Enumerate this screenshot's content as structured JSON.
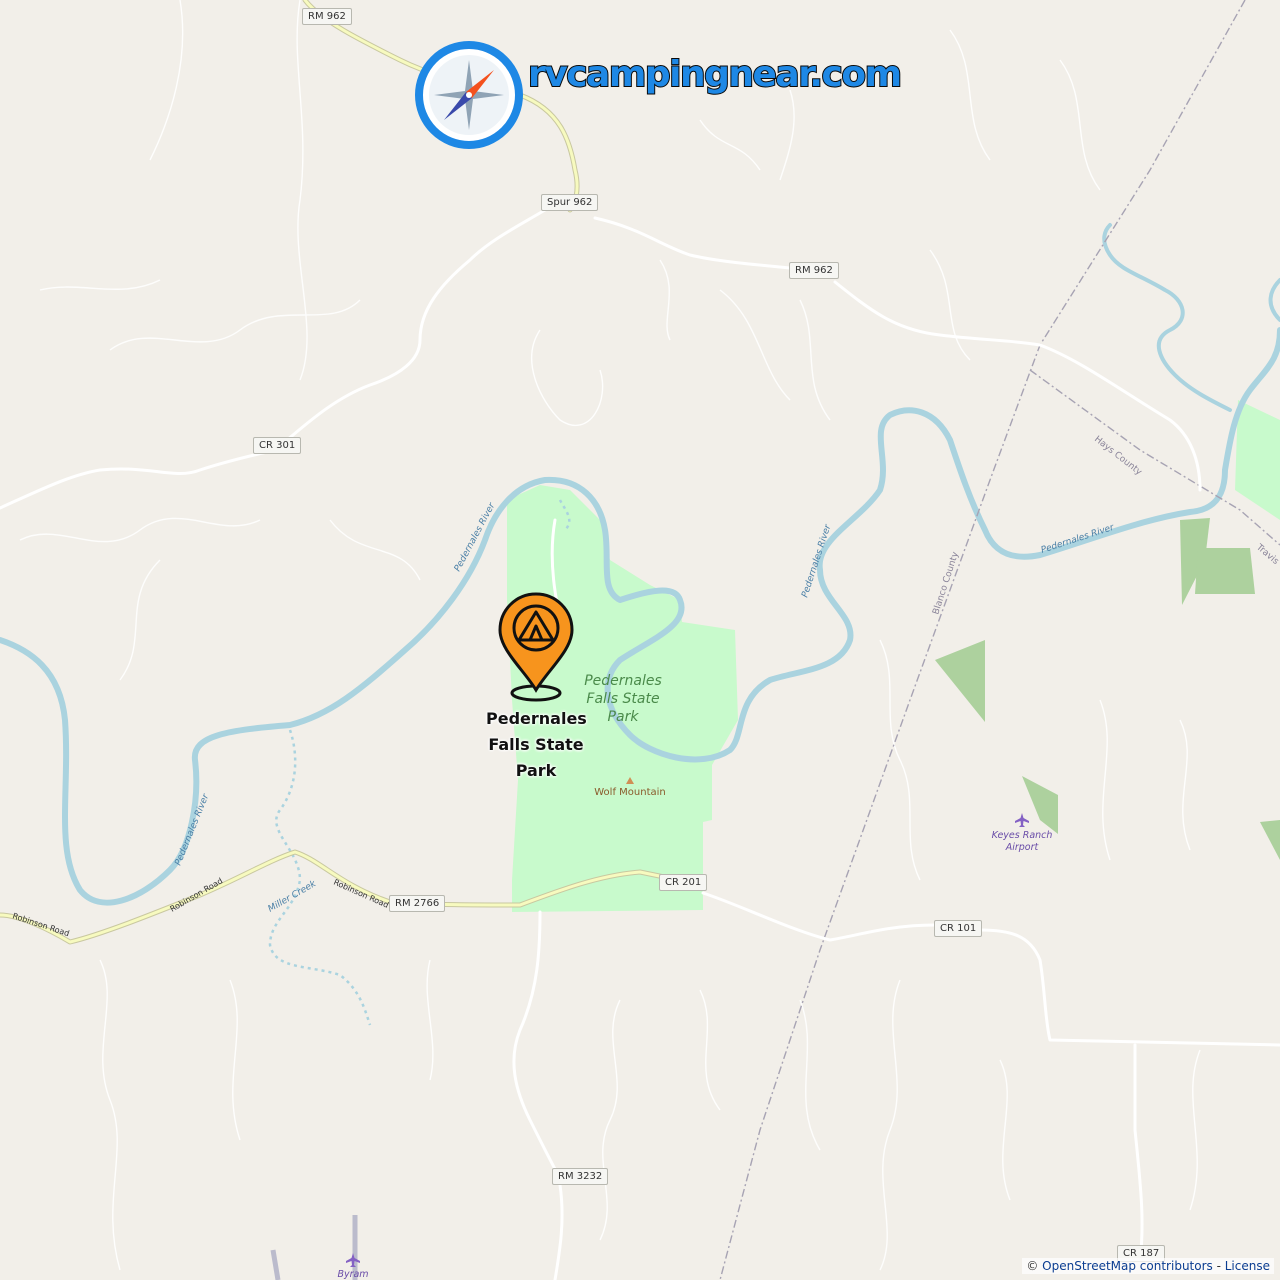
{
  "brand": {
    "text": "rvcampingnear.com",
    "icon": "compass-icon"
  },
  "marker": {
    "label": "Pedernales Falls State Park",
    "icon": "tent-icon"
  },
  "road_labels": {
    "rm962_top": "RM 962",
    "spur962": "Spur 962",
    "rm962_mid": "RM 962",
    "cr301": "CR 301",
    "cr201": "CR 201",
    "rm2766": "RM 2766",
    "cr101": "CR 101",
    "rm3232": "RM 3232",
    "cr187": "CR 187"
  },
  "map_labels": {
    "park": "Pedernales Falls State Park",
    "wolf_mountain": "Wolf Mountain",
    "keyes_airport": "Keyes Ranch Airport",
    "byram": "Byram",
    "river1": "Pedernales River",
    "river2": "Pedernales River",
    "river3": "Pedernales River",
    "river4": "Pedernales River",
    "miller_creek": "Miller Creek",
    "robinson1": "Robinson Road",
    "robinson2": "Robinson Road",
    "robinson3": "Robinson Road",
    "hays_county": "Hays County",
    "blanco_county": "Blanco County",
    "travis": "Travis"
  },
  "attribution": {
    "copyright": "© ",
    "osm": "OpenStreetMap contributors",
    "sep": " - ",
    "license": "License"
  },
  "colors": {
    "water": "#aad3df",
    "park": "#c8facc",
    "road": "#ffffff",
    "secondary_road": "#f7fabf",
    "pin": "#f7941d",
    "brand": "#1e88e5"
  }
}
